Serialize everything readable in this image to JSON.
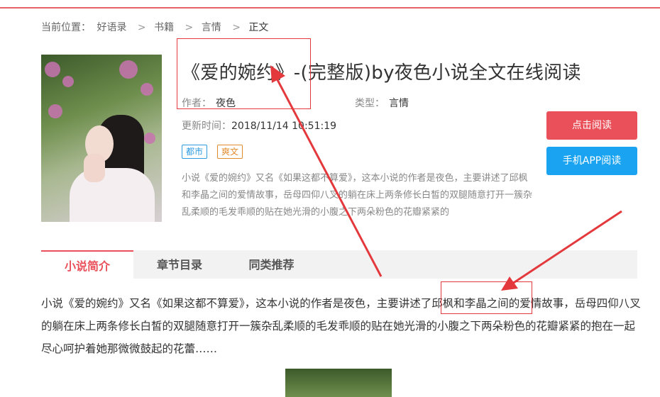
{
  "breadcrumb": {
    "prefix": "当前位置：",
    "items": [
      "好语录",
      "书籍",
      "言情"
    ],
    "separator": ">",
    "current": "正文"
  },
  "book": {
    "title": "《爱的婉约》-(完整版)by夜色小说全文在线阅读",
    "author_label": "作者：",
    "author": "夜色",
    "type_label": "类型：",
    "type": "言情",
    "updated_label": "更新时间：",
    "updated": "2018/11/14 10:51:19",
    "tags": [
      "都市",
      "爽文"
    ],
    "summary": "小说《爱的婉约》又名《如果这都不算爱》，这本小说的作者是夜色，主要讲述了邱枫和李晶之间的爱情故事，岳母四仰八叉的躺在床上两条修长白皙的双腿随意打开一簇杂乱柔顺的毛发乖顺的贴在她光滑的小腹之下两朵粉色的花瓣紧紧的"
  },
  "buttons": {
    "read": "点击阅读",
    "app": "手机APP阅读"
  },
  "tabs": [
    "小说简介",
    "章节目录",
    "同类推荐"
  ],
  "intro_text": "小说《爱的婉约》又名《如果这都不算爱》，这本小说的作者是夜色，主要讲述了邱枫和李晶之间的爱情故事，岳母四仰八叉的躺在床上两条修长白皙的双腿随意打开一簇杂乱柔顺的毛发乖顺的贴在她光滑的小腹之下两朵粉色的花瓣紧紧的抱在一起尽心呵护着她那微微鼓起的花蕾……",
  "colors": {
    "accent_red": "#e9505a",
    "accent_blue": "#19a3f0",
    "annotation_red": "#e4393c",
    "tag_blue": "#2e9be0",
    "tag_orange": "#e28b2c"
  }
}
